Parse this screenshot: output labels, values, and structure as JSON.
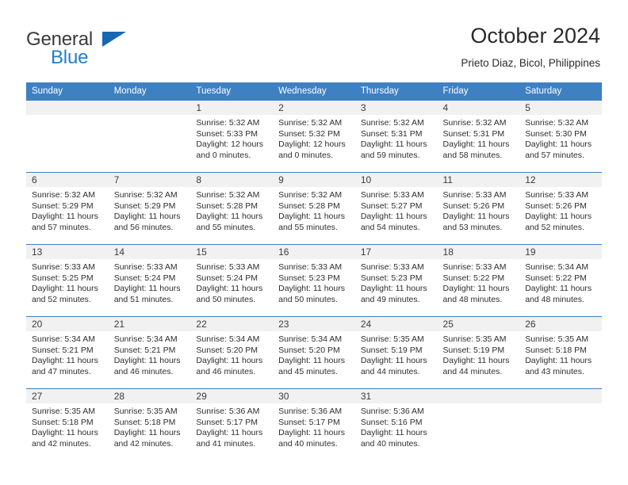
{
  "brand": {
    "name_top": "General",
    "name_bottom": "Blue",
    "triangle_color": "#1668b3",
    "top_color": "#3a3a3a",
    "bottom_color": "#1f7fd0"
  },
  "header": {
    "title": "October 2024",
    "subtitle": "Prieto Diaz, Bicol, Philippines"
  },
  "theme": {
    "header_bg": "#3f80c2",
    "header_text": "#ffffff",
    "daynum_band": "#f1f1f1",
    "grid_line": "#3f80c2",
    "body_text": "#2e2e2e"
  },
  "weekdays": [
    "Sunday",
    "Monday",
    "Tuesday",
    "Wednesday",
    "Thursday",
    "Friday",
    "Saturday"
  ],
  "weeks": [
    [
      {
        "day": "",
        "blank": true,
        "sunrise": "",
        "sunset": "",
        "daylight_line1": "",
        "daylight_line2": ""
      },
      {
        "day": "",
        "blank": true,
        "sunrise": "",
        "sunset": "",
        "daylight_line1": "",
        "daylight_line2": ""
      },
      {
        "day": "1",
        "blank": false,
        "sunrise": "Sunrise: 5:32 AM",
        "sunset": "Sunset: 5:33 PM",
        "daylight_line1": "Daylight: 12 hours",
        "daylight_line2": "and 0 minutes."
      },
      {
        "day": "2",
        "blank": false,
        "sunrise": "Sunrise: 5:32 AM",
        "sunset": "Sunset: 5:32 PM",
        "daylight_line1": "Daylight: 12 hours",
        "daylight_line2": "and 0 minutes."
      },
      {
        "day": "3",
        "blank": false,
        "sunrise": "Sunrise: 5:32 AM",
        "sunset": "Sunset: 5:31 PM",
        "daylight_line1": "Daylight: 11 hours",
        "daylight_line2": "and 59 minutes."
      },
      {
        "day": "4",
        "blank": false,
        "sunrise": "Sunrise: 5:32 AM",
        "sunset": "Sunset: 5:31 PM",
        "daylight_line1": "Daylight: 11 hours",
        "daylight_line2": "and 58 minutes."
      },
      {
        "day": "5",
        "blank": false,
        "sunrise": "Sunrise: 5:32 AM",
        "sunset": "Sunset: 5:30 PM",
        "daylight_line1": "Daylight: 11 hours",
        "daylight_line2": "and 57 minutes."
      }
    ],
    [
      {
        "day": "6",
        "blank": false,
        "sunrise": "Sunrise: 5:32 AM",
        "sunset": "Sunset: 5:29 PM",
        "daylight_line1": "Daylight: 11 hours",
        "daylight_line2": "and 57 minutes."
      },
      {
        "day": "7",
        "blank": false,
        "sunrise": "Sunrise: 5:32 AM",
        "sunset": "Sunset: 5:29 PM",
        "daylight_line1": "Daylight: 11 hours",
        "daylight_line2": "and 56 minutes."
      },
      {
        "day": "8",
        "blank": false,
        "sunrise": "Sunrise: 5:32 AM",
        "sunset": "Sunset: 5:28 PM",
        "daylight_line1": "Daylight: 11 hours",
        "daylight_line2": "and 55 minutes."
      },
      {
        "day": "9",
        "blank": false,
        "sunrise": "Sunrise: 5:32 AM",
        "sunset": "Sunset: 5:28 PM",
        "daylight_line1": "Daylight: 11 hours",
        "daylight_line2": "and 55 minutes."
      },
      {
        "day": "10",
        "blank": false,
        "sunrise": "Sunrise: 5:33 AM",
        "sunset": "Sunset: 5:27 PM",
        "daylight_line1": "Daylight: 11 hours",
        "daylight_line2": "and 54 minutes."
      },
      {
        "day": "11",
        "blank": false,
        "sunrise": "Sunrise: 5:33 AM",
        "sunset": "Sunset: 5:26 PM",
        "daylight_line1": "Daylight: 11 hours",
        "daylight_line2": "and 53 minutes."
      },
      {
        "day": "12",
        "blank": false,
        "sunrise": "Sunrise: 5:33 AM",
        "sunset": "Sunset: 5:26 PM",
        "daylight_line1": "Daylight: 11 hours",
        "daylight_line2": "and 52 minutes."
      }
    ],
    [
      {
        "day": "13",
        "blank": false,
        "sunrise": "Sunrise: 5:33 AM",
        "sunset": "Sunset: 5:25 PM",
        "daylight_line1": "Daylight: 11 hours",
        "daylight_line2": "and 52 minutes."
      },
      {
        "day": "14",
        "blank": false,
        "sunrise": "Sunrise: 5:33 AM",
        "sunset": "Sunset: 5:24 PM",
        "daylight_line1": "Daylight: 11 hours",
        "daylight_line2": "and 51 minutes."
      },
      {
        "day": "15",
        "blank": false,
        "sunrise": "Sunrise: 5:33 AM",
        "sunset": "Sunset: 5:24 PM",
        "daylight_line1": "Daylight: 11 hours",
        "daylight_line2": "and 50 minutes."
      },
      {
        "day": "16",
        "blank": false,
        "sunrise": "Sunrise: 5:33 AM",
        "sunset": "Sunset: 5:23 PM",
        "daylight_line1": "Daylight: 11 hours",
        "daylight_line2": "and 50 minutes."
      },
      {
        "day": "17",
        "blank": false,
        "sunrise": "Sunrise: 5:33 AM",
        "sunset": "Sunset: 5:23 PM",
        "daylight_line1": "Daylight: 11 hours",
        "daylight_line2": "and 49 minutes."
      },
      {
        "day": "18",
        "blank": false,
        "sunrise": "Sunrise: 5:33 AM",
        "sunset": "Sunset: 5:22 PM",
        "daylight_line1": "Daylight: 11 hours",
        "daylight_line2": "and 48 minutes."
      },
      {
        "day": "19",
        "blank": false,
        "sunrise": "Sunrise: 5:34 AM",
        "sunset": "Sunset: 5:22 PM",
        "daylight_line1": "Daylight: 11 hours",
        "daylight_line2": "and 48 minutes."
      }
    ],
    [
      {
        "day": "20",
        "blank": false,
        "sunrise": "Sunrise: 5:34 AM",
        "sunset": "Sunset: 5:21 PM",
        "daylight_line1": "Daylight: 11 hours",
        "daylight_line2": "and 47 minutes."
      },
      {
        "day": "21",
        "blank": false,
        "sunrise": "Sunrise: 5:34 AM",
        "sunset": "Sunset: 5:21 PM",
        "daylight_line1": "Daylight: 11 hours",
        "daylight_line2": "and 46 minutes."
      },
      {
        "day": "22",
        "blank": false,
        "sunrise": "Sunrise: 5:34 AM",
        "sunset": "Sunset: 5:20 PM",
        "daylight_line1": "Daylight: 11 hours",
        "daylight_line2": "and 46 minutes."
      },
      {
        "day": "23",
        "blank": false,
        "sunrise": "Sunrise: 5:34 AM",
        "sunset": "Sunset: 5:20 PM",
        "daylight_line1": "Daylight: 11 hours",
        "daylight_line2": "and 45 minutes."
      },
      {
        "day": "24",
        "blank": false,
        "sunrise": "Sunrise: 5:35 AM",
        "sunset": "Sunset: 5:19 PM",
        "daylight_line1": "Daylight: 11 hours",
        "daylight_line2": "and 44 minutes."
      },
      {
        "day": "25",
        "blank": false,
        "sunrise": "Sunrise: 5:35 AM",
        "sunset": "Sunset: 5:19 PM",
        "daylight_line1": "Daylight: 11 hours",
        "daylight_line2": "and 44 minutes."
      },
      {
        "day": "26",
        "blank": false,
        "sunrise": "Sunrise: 5:35 AM",
        "sunset": "Sunset: 5:18 PM",
        "daylight_line1": "Daylight: 11 hours",
        "daylight_line2": "and 43 minutes."
      }
    ],
    [
      {
        "day": "27",
        "blank": false,
        "sunrise": "Sunrise: 5:35 AM",
        "sunset": "Sunset: 5:18 PM",
        "daylight_line1": "Daylight: 11 hours",
        "daylight_line2": "and 42 minutes."
      },
      {
        "day": "28",
        "blank": false,
        "sunrise": "Sunrise: 5:35 AM",
        "sunset": "Sunset: 5:18 PM",
        "daylight_line1": "Daylight: 11 hours",
        "daylight_line2": "and 42 minutes."
      },
      {
        "day": "29",
        "blank": false,
        "sunrise": "Sunrise: 5:36 AM",
        "sunset": "Sunset: 5:17 PM",
        "daylight_line1": "Daylight: 11 hours",
        "daylight_line2": "and 41 minutes."
      },
      {
        "day": "30",
        "blank": false,
        "sunrise": "Sunrise: 5:36 AM",
        "sunset": "Sunset: 5:17 PM",
        "daylight_line1": "Daylight: 11 hours",
        "daylight_line2": "and 40 minutes."
      },
      {
        "day": "31",
        "blank": false,
        "sunrise": "Sunrise: 5:36 AM",
        "sunset": "Sunset: 5:16 PM",
        "daylight_line1": "Daylight: 11 hours",
        "daylight_line2": "and 40 minutes."
      },
      {
        "day": "",
        "blank": true,
        "sunrise": "",
        "sunset": "",
        "daylight_line1": "",
        "daylight_line2": ""
      },
      {
        "day": "",
        "blank": true,
        "sunrise": "",
        "sunset": "",
        "daylight_line1": "",
        "daylight_line2": ""
      }
    ]
  ]
}
